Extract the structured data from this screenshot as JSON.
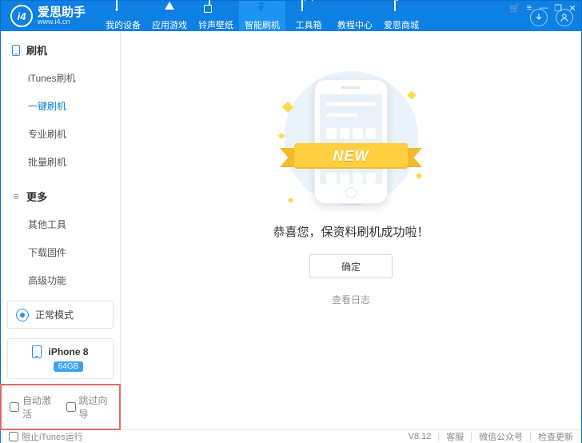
{
  "header": {
    "brand_name": "爱思助手",
    "brand_sub": "www.i4.cn",
    "logo_letters": "i4",
    "nav": [
      {
        "label": "我的设备",
        "icon": "phone-icon"
      },
      {
        "label": "应用游戏",
        "icon": "apps-icon"
      },
      {
        "label": "铃声壁纸",
        "icon": "media-icon"
      },
      {
        "label": "智能刷机",
        "icon": "flash-icon"
      },
      {
        "label": "工具箱",
        "icon": "toolbox-icon"
      },
      {
        "label": "教程中心",
        "icon": "tutorial-icon"
      },
      {
        "label": "爱思商城",
        "icon": "shop-icon"
      }
    ],
    "active_nav_index": 3,
    "win_controls": {
      "cart": "🛒",
      "menu": "≡",
      "min": "—",
      "max": "❐",
      "close": "✕"
    }
  },
  "sidebar": {
    "sections": [
      {
        "title": "刷机",
        "icon": "phone-icon",
        "items": [
          {
            "label": "iTunes刷机"
          },
          {
            "label": "一键刷机",
            "active": true
          },
          {
            "label": "专业刷机"
          },
          {
            "label": "批量刷机"
          }
        ]
      },
      {
        "title": "更多",
        "icon": "menu-icon",
        "items": [
          {
            "label": "其他工具"
          },
          {
            "label": "下载固件"
          },
          {
            "label": "高级功能"
          }
        ]
      }
    ],
    "mode_label": "正常模式",
    "device": {
      "name": "iPhone 8",
      "storage": "64GB"
    },
    "checkbox1_label": "自动激活",
    "checkbox2_label": "跳过向导"
  },
  "main": {
    "ribbon_text": "NEW",
    "message": "恭喜您，保资料刷机成功啦！",
    "confirm_label": "确定",
    "log_link": "查看日志"
  },
  "status": {
    "block_itunes_label": "阻止iTunes运行",
    "version": "V8.12",
    "link1": "客服",
    "link2": "微信公众号",
    "link3": "检查更新"
  }
}
